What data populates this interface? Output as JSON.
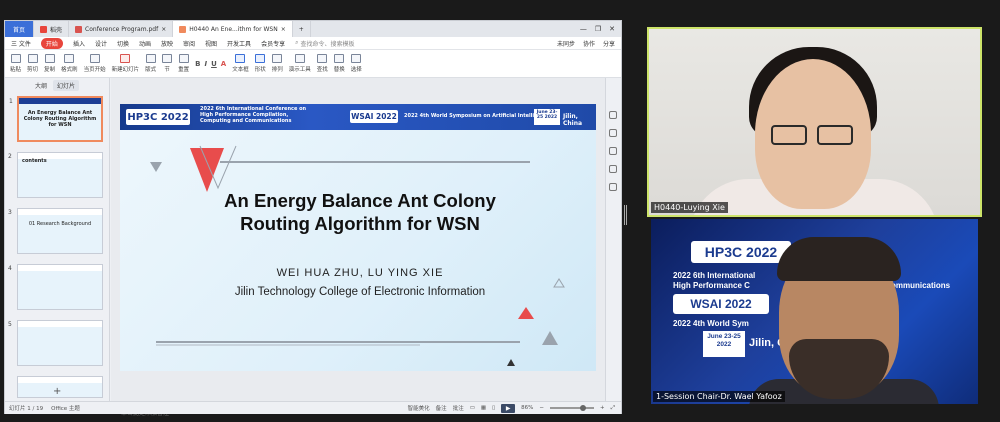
{
  "tabs": [
    {
      "label": "首页"
    },
    {
      "label": "稻壳"
    },
    {
      "label": "Conference Program.pdf"
    },
    {
      "label": "H0440 An Ene...ithm for WSN"
    }
  ],
  "menu": {
    "file": "三 文件",
    "start": "开始",
    "items": [
      "插入",
      "设计",
      "切换",
      "动画",
      "放映",
      "审阅",
      "视图",
      "开发工具",
      "会员专享"
    ],
    "search": "查找命令、搜索模板",
    "right": [
      "未同步",
      "协作",
      "分享"
    ]
  },
  "toolbar": {
    "items": [
      "粘贴",
      "剪切",
      "复制",
      "格式刷",
      "当页开始",
      "新建幻灯片",
      "版式",
      "节",
      "重置",
      "文本框",
      "形状",
      "排列",
      "演示工具",
      "查找",
      "替换",
      "选择"
    ]
  },
  "panel": {
    "outline_tab": "大纲",
    "slides_tab": "幻灯片",
    "thumbs": [
      {
        "num": "1",
        "title": "An Energy Balance Ant Colony Routing Algorithm for WSN"
      },
      {
        "num": "2",
        "title": "contents"
      },
      {
        "num": "3",
        "title": "01 Research Background"
      },
      {
        "num": "4",
        "title": ""
      },
      {
        "num": "5",
        "title": ""
      },
      {
        "num": "6",
        "title": ""
      }
    ],
    "add": "+"
  },
  "slide": {
    "banner_logo": "HP3C 2022",
    "banner_conf": "2022 6th International Conference on High Performance Compilation, Computing and Communications",
    "banner_wsai": "WSAI 2022",
    "banner_wsai_text": "2022 4th World Symposium on Artificial Intelligence",
    "banner_date": "June 23-25 2022",
    "banner_place": "Jilin, China",
    "title": "An Energy Balance Ant Colony Routing Algorithm for WSN",
    "authors": "WEI HUA ZHU, LU YING XIE",
    "institution": "Jilin Technology College of Electronic Information"
  },
  "notes": "单击此处添加备注",
  "status": {
    "slide_count": "幻灯片 1 / 19",
    "theme": "Office 主题",
    "smart": "智能美化",
    "notes_btn": "备注",
    "comment": "批注",
    "zoom": "86%"
  },
  "videos": [
    {
      "name": "H0440-Luying Xie"
    },
    {
      "name": "1-Session Chair-Dr. Wael Yafooz"
    }
  ],
  "video2_bg": {
    "hp3c": "HP3C 2022",
    "line1": "2022 6th International",
    "line2": "High Performance C",
    "line3": "ommunications",
    "wsai": "WSAI 2022",
    "line4": "2022 4th World Sym",
    "date": "June 23-25 2022",
    "place": "Jilin, C"
  },
  "colors": {
    "accent": "#3b6fd8",
    "start": "#e8453c",
    "banner": "#1d3f96",
    "active_speaker": "#cde46a"
  }
}
